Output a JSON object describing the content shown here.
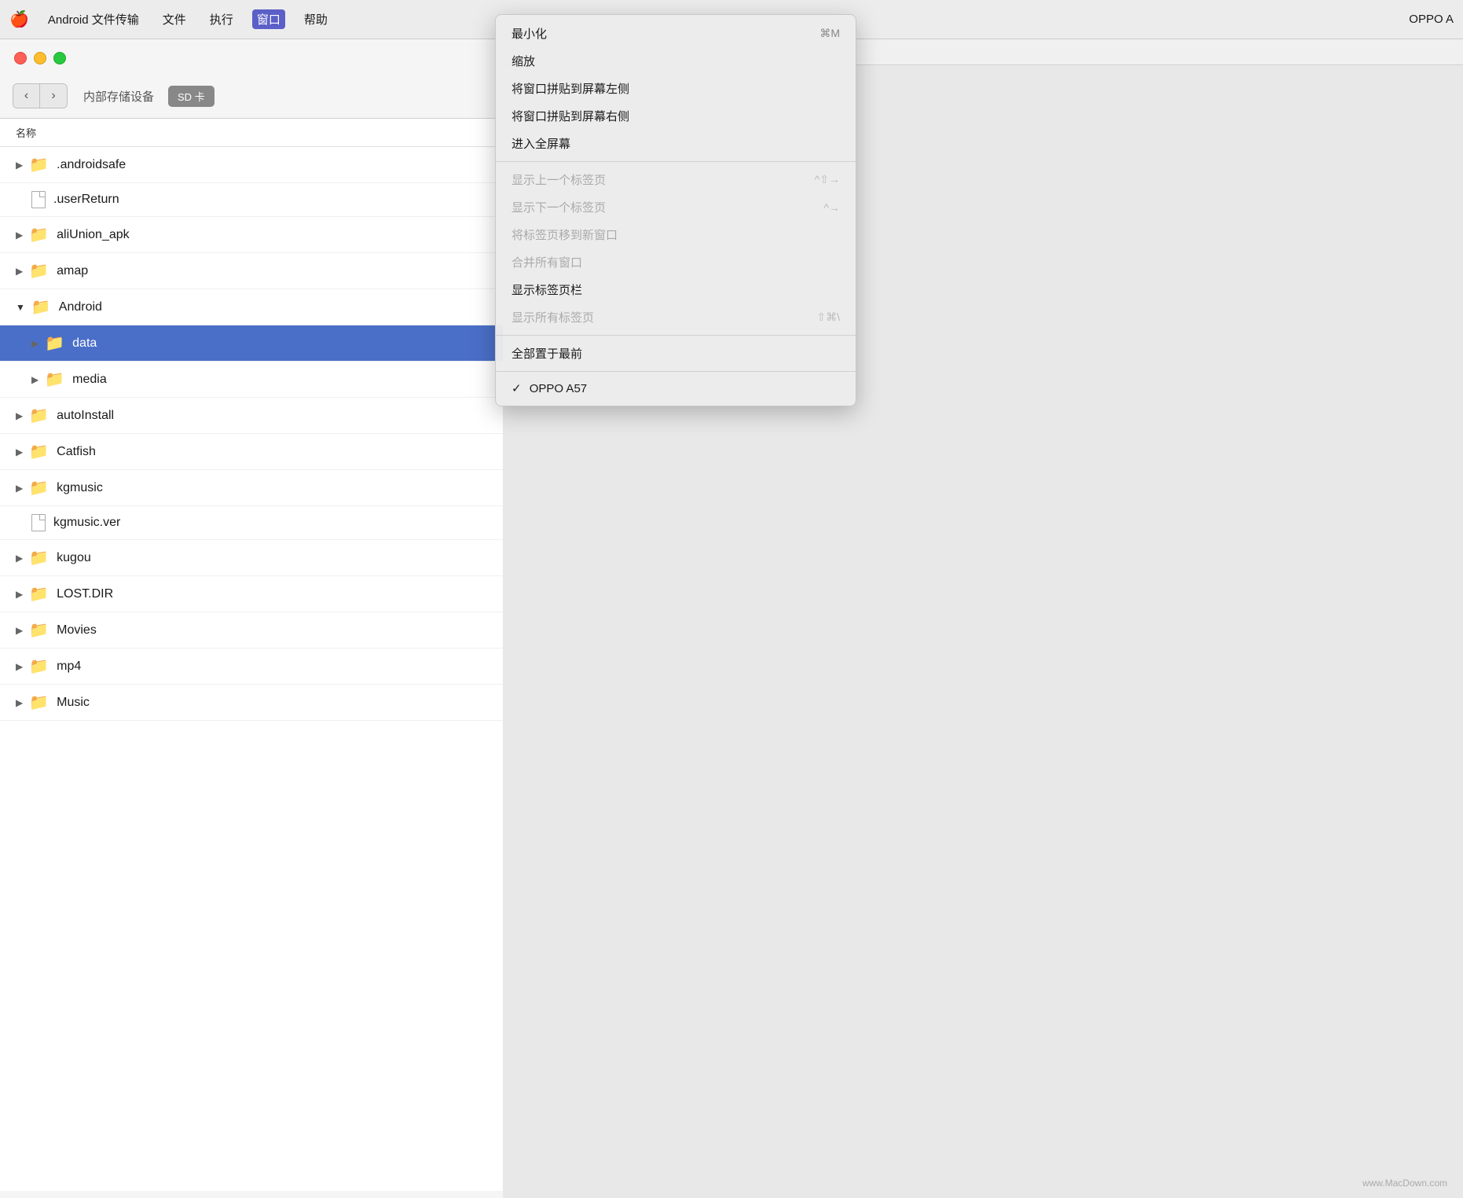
{
  "menubar": {
    "apple_icon": "🍎",
    "items": [
      {
        "label": "Android 文件传输",
        "active": false
      },
      {
        "label": "文件",
        "active": false
      },
      {
        "label": "执行",
        "active": false
      },
      {
        "label": "窗口",
        "active": true
      },
      {
        "label": "帮助",
        "active": false
      }
    ],
    "right_label": "OPPO A"
  },
  "toolbar": {
    "back_label": "‹",
    "forward_label": "›",
    "storage_label": "内部存储设备",
    "sd_label": "SD 卡"
  },
  "filelist": {
    "column_header": "名称",
    "items": [
      {
        "type": "folder",
        "name": ".androidsafe",
        "indent": 0,
        "expanded": false,
        "selected": false
      },
      {
        "type": "file",
        "name": ".userReturn",
        "indent": 0,
        "selected": false
      },
      {
        "type": "folder",
        "name": "aliUnion_apk",
        "indent": 0,
        "expanded": false,
        "selected": false
      },
      {
        "type": "folder",
        "name": "amap",
        "indent": 0,
        "expanded": false,
        "selected": false
      },
      {
        "type": "folder",
        "name": "Android",
        "indent": 0,
        "expanded": true,
        "selected": false
      },
      {
        "type": "folder",
        "name": "data",
        "indent": 1,
        "expanded": false,
        "selected": true
      },
      {
        "type": "folder",
        "name": "media",
        "indent": 1,
        "expanded": false,
        "selected": false
      },
      {
        "type": "folder",
        "name": "autoInstall",
        "indent": 0,
        "expanded": false,
        "selected": false
      },
      {
        "type": "folder",
        "name": "Catfish",
        "indent": 0,
        "expanded": false,
        "selected": false
      },
      {
        "type": "folder",
        "name": "kgmusic",
        "indent": 0,
        "expanded": false,
        "selected": false
      },
      {
        "type": "file",
        "name": "kgmusic.ver",
        "indent": 0,
        "selected": false
      },
      {
        "type": "folder",
        "name": "kugou",
        "indent": 0,
        "expanded": false,
        "selected": false
      },
      {
        "type": "folder",
        "name": "LOST.DIR",
        "indent": 0,
        "expanded": false,
        "selected": false
      },
      {
        "type": "folder",
        "name": "Movies",
        "indent": 0,
        "expanded": false,
        "selected": false
      },
      {
        "type": "folder",
        "name": "mp4",
        "indent": 0,
        "expanded": false,
        "selected": false
      },
      {
        "type": "folder",
        "name": "Music",
        "indent": 0,
        "expanded": false,
        "selected": false
      }
    ]
  },
  "dropdown": {
    "items": [
      {
        "label": "最小化",
        "shortcut": "⌘M",
        "disabled": false,
        "check": false,
        "separator_after": false
      },
      {
        "label": "缩放",
        "shortcut": "",
        "disabled": false,
        "check": false,
        "separator_after": false
      },
      {
        "label": "将窗口拼贴到屏幕左侧",
        "shortcut": "",
        "disabled": false,
        "check": false,
        "separator_after": false
      },
      {
        "label": "将窗口拼贴到屏幕右侧",
        "shortcut": "",
        "disabled": false,
        "check": false,
        "separator_after": false
      },
      {
        "label": "进入全屏幕",
        "shortcut": "",
        "disabled": false,
        "check": false,
        "separator_after": true
      },
      {
        "label": "显示上一个标签页",
        "shortcut": "^⇧→",
        "disabled": true,
        "check": false,
        "separator_after": false
      },
      {
        "label": "显示下一个标签页",
        "shortcut": "^→",
        "disabled": true,
        "check": false,
        "separator_after": false
      },
      {
        "label": "将标签页移到新窗口",
        "shortcut": "",
        "disabled": true,
        "check": false,
        "separator_after": false
      },
      {
        "label": "合并所有窗口",
        "shortcut": "",
        "disabled": true,
        "check": false,
        "separator_after": false
      },
      {
        "label": "显示标签页栏",
        "shortcut": "",
        "disabled": false,
        "check": false,
        "separator_after": false
      },
      {
        "label": "显示所有标签页",
        "shortcut": "⇧⌘\\",
        "disabled": true,
        "check": false,
        "separator_after": true
      },
      {
        "label": "全部置于最前",
        "shortcut": "",
        "disabled": false,
        "check": false,
        "separator_after": true
      },
      {
        "label": "OPPO A57",
        "shortcut": "",
        "disabled": false,
        "check": true,
        "separator_after": false
      }
    ]
  },
  "watermark": "www.MacDown.com"
}
